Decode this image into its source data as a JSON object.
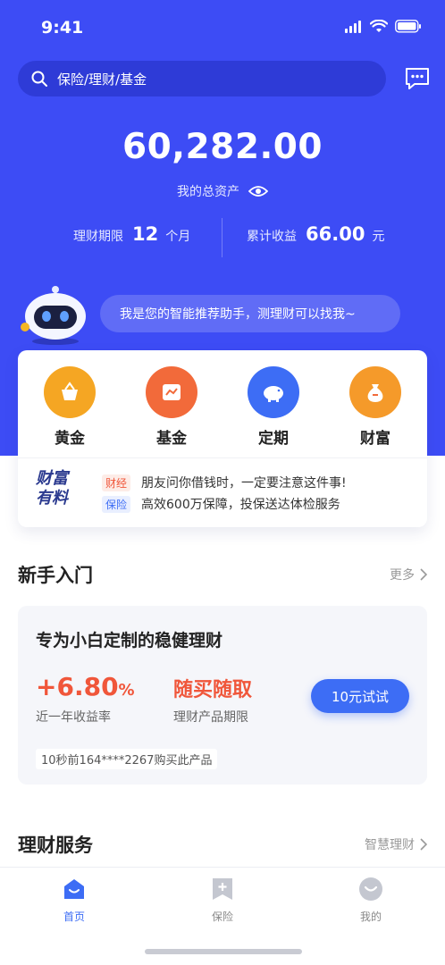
{
  "status": {
    "time": "9:41"
  },
  "search": {
    "placeholder": "保险/理财/基金"
  },
  "assets": {
    "total": "60,282.00",
    "label": "我的总资产"
  },
  "stats": {
    "term_label": "理财期限",
    "term_value": "12",
    "term_unit": "个月",
    "income_label": "累计收益",
    "income_value": "66.00",
    "income_unit": "元"
  },
  "assistant": {
    "text": "我是您的智能推荐助手，测理财可以找我~"
  },
  "categories": [
    {
      "label": "黄金",
      "icon": "basket-icon",
      "color": "#f5a623"
    },
    {
      "label": "基金",
      "icon": "chart-icon",
      "color": "#f26a3a"
    },
    {
      "label": "定期",
      "icon": "piggy-bank-icon",
      "color": "#3d6df5"
    },
    {
      "label": "财富",
      "icon": "money-bag-icon",
      "color": "#f59a2a"
    }
  ],
  "news": {
    "logo_line1": "财富",
    "logo_line2": "有料",
    "items": [
      {
        "tag": "财经",
        "text": "朋友问你借钱时，一定要注意这件事!"
      },
      {
        "tag": "保险",
        "text": "高效600万保障，投保送达体检服务"
      }
    ]
  },
  "beginner": {
    "title": "新手入门",
    "more": "更多",
    "product_title": "专为小白定制的稳健理财",
    "rate_value": "+6.80",
    "rate_unit": "%",
    "rate_label": "近一年收益率",
    "flex_text": "随买随取",
    "flex_label": "理财产品期限",
    "button": "10元试试",
    "buy_note": "10秒前164****2267购买此产品"
  },
  "services": {
    "title": "理财服务",
    "more": "智慧理财"
  },
  "tabs": [
    {
      "label": "首页",
      "active": true
    },
    {
      "label": "保险",
      "active": false
    },
    {
      "label": "我的",
      "active": false
    }
  ],
  "colors": {
    "primary": "#3d4cf5",
    "accent": "#f0563a",
    "button": "#3d6df5"
  }
}
